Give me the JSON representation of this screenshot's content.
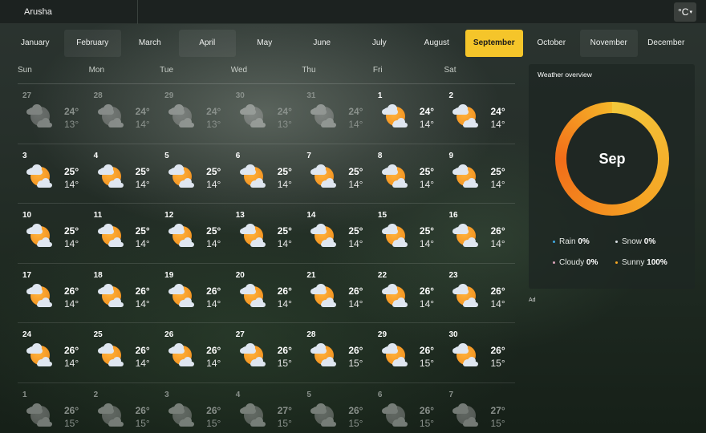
{
  "header": {
    "location": "Arusha",
    "unit_label": "°C",
    "unit_caret": "▾"
  },
  "months": [
    {
      "label": "January",
      "active": false,
      "dim": false
    },
    {
      "label": "February",
      "active": false,
      "dim": true
    },
    {
      "label": "March",
      "active": false,
      "dim": false
    },
    {
      "label": "April",
      "active": false,
      "dim": true
    },
    {
      "label": "May",
      "active": false,
      "dim": false
    },
    {
      "label": "June",
      "active": false,
      "dim": false
    },
    {
      "label": "July",
      "active": false,
      "dim": false
    },
    {
      "label": "August",
      "active": false,
      "dim": false
    },
    {
      "label": "September",
      "active": true,
      "dim": false
    },
    {
      "label": "October",
      "active": false,
      "dim": false
    },
    {
      "label": "November",
      "active": false,
      "dim": true
    },
    {
      "label": "December",
      "active": false,
      "dim": false
    }
  ],
  "weekdays": [
    "Sun",
    "Mon",
    "Tue",
    "Wed",
    "Thu",
    "Fri",
    "Sat"
  ],
  "weeks": [
    [
      {
        "day": "27",
        "high": "24°",
        "low": "13°",
        "other": true
      },
      {
        "day": "28",
        "high": "24°",
        "low": "14°",
        "other": true
      },
      {
        "day": "29",
        "high": "24°",
        "low": "13°",
        "other": true
      },
      {
        "day": "30",
        "high": "24°",
        "low": "13°",
        "other": true
      },
      {
        "day": "31",
        "high": "24°",
        "low": "14°",
        "other": true
      },
      {
        "day": "1",
        "high": "24°",
        "low": "14°",
        "other": false
      },
      {
        "day": "2",
        "high": "24°",
        "low": "14°",
        "other": false
      }
    ],
    [
      {
        "day": "3",
        "high": "25°",
        "low": "14°",
        "other": false
      },
      {
        "day": "4",
        "high": "25°",
        "low": "14°",
        "other": false
      },
      {
        "day": "5",
        "high": "25°",
        "low": "14°",
        "other": false
      },
      {
        "day": "6",
        "high": "25°",
        "low": "14°",
        "other": false
      },
      {
        "day": "7",
        "high": "25°",
        "low": "14°",
        "other": false
      },
      {
        "day": "8",
        "high": "25°",
        "low": "14°",
        "other": false
      },
      {
        "day": "9",
        "high": "25°",
        "low": "14°",
        "other": false
      }
    ],
    [
      {
        "day": "10",
        "high": "25°",
        "low": "14°",
        "other": false
      },
      {
        "day": "11",
        "high": "25°",
        "low": "14°",
        "other": false
      },
      {
        "day": "12",
        "high": "25°",
        "low": "14°",
        "other": false
      },
      {
        "day": "13",
        "high": "25°",
        "low": "14°",
        "other": false
      },
      {
        "day": "14",
        "high": "25°",
        "low": "14°",
        "other": false
      },
      {
        "day": "15",
        "high": "25°",
        "low": "14°",
        "other": false
      },
      {
        "day": "16",
        "high": "26°",
        "low": "14°",
        "other": false
      }
    ],
    [
      {
        "day": "17",
        "high": "26°",
        "low": "14°",
        "other": false
      },
      {
        "day": "18",
        "high": "26°",
        "low": "14°",
        "other": false
      },
      {
        "day": "19",
        "high": "26°",
        "low": "14°",
        "other": false
      },
      {
        "day": "20",
        "high": "26°",
        "low": "14°",
        "other": false
      },
      {
        "day": "21",
        "high": "26°",
        "low": "14°",
        "other": false
      },
      {
        "day": "22",
        "high": "26°",
        "low": "14°",
        "other": false
      },
      {
        "day": "23",
        "high": "26°",
        "low": "14°",
        "other": false
      }
    ],
    [
      {
        "day": "24",
        "high": "26°",
        "low": "14°",
        "other": false
      },
      {
        "day": "25",
        "high": "26°",
        "low": "14°",
        "other": false
      },
      {
        "day": "26",
        "high": "26°",
        "low": "14°",
        "other": false
      },
      {
        "day": "27",
        "high": "26°",
        "low": "15°",
        "other": false
      },
      {
        "day": "28",
        "high": "26°",
        "low": "15°",
        "other": false
      },
      {
        "day": "29",
        "high": "26°",
        "low": "15°",
        "other": false
      },
      {
        "day": "30",
        "high": "26°",
        "low": "15°",
        "other": false
      }
    ],
    [
      {
        "day": "1",
        "high": "26°",
        "low": "15°",
        "other": true
      },
      {
        "day": "2",
        "high": "26°",
        "low": "15°",
        "other": true
      },
      {
        "day": "3",
        "high": "26°",
        "low": "15°",
        "other": true
      },
      {
        "day": "4",
        "high": "27°",
        "low": "15°",
        "other": true
      },
      {
        "day": "5",
        "high": "26°",
        "low": "15°",
        "other": true
      },
      {
        "day": "6",
        "high": "26°",
        "low": "15°",
        "other": true
      },
      {
        "day": "7",
        "high": "27°",
        "low": "15°",
        "other": true
      }
    ]
  ],
  "day_icon": "sun-behind-cloud-icon",
  "overview": {
    "title": "Weather overview",
    "month_abbr": "Sep",
    "stats": [
      {
        "label": "Rain",
        "value": "0%",
        "color": "#3fa9e0"
      },
      {
        "label": "Snow",
        "value": "0%",
        "color": "#d8dde2"
      },
      {
        "label": "Cloudy",
        "value": "0%",
        "color": "#d9a3b8"
      },
      {
        "label": "Sunny",
        "value": "100%",
        "color": "#f5a623"
      }
    ]
  },
  "ad_label": "Ad",
  "colors": {
    "accent": "#f5c52a",
    "donut_start": "#f26d19",
    "donut_end": "#f3c73b"
  }
}
